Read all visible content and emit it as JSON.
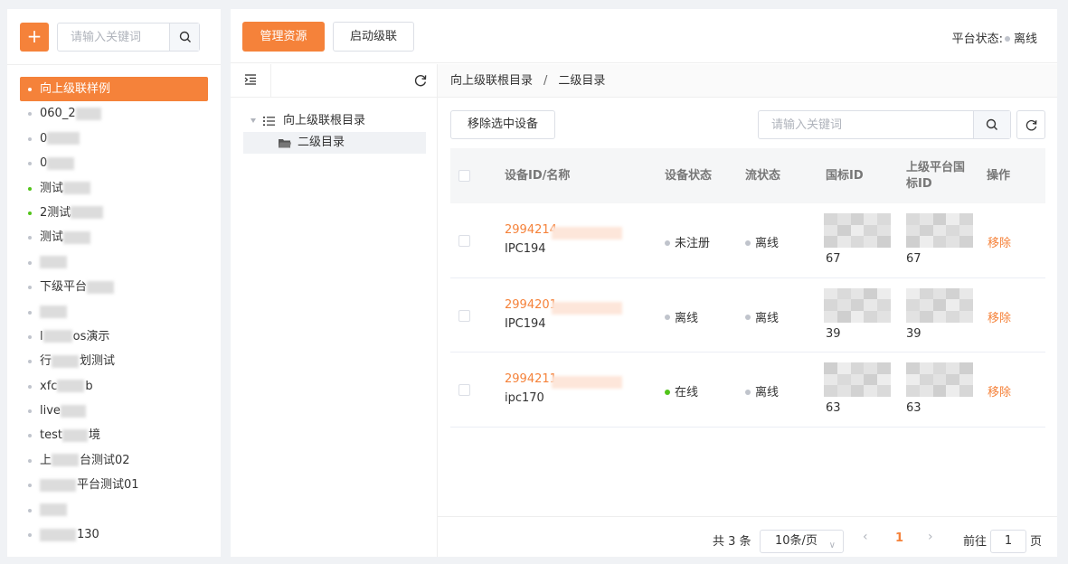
{
  "sidebar": {
    "add_label": "+",
    "search_placeholder": "请输入关键词",
    "items": [
      {
        "label": "向上级联样例",
        "active": true,
        "dot": "white"
      },
      {
        "label": "060_2",
        "dot": "gray"
      },
      {
        "label": "0",
        "dot": "gray"
      },
      {
        "label": "0",
        "dot": "gray"
      },
      {
        "label": "测试",
        "dot": "green"
      },
      {
        "label": "2测试",
        "dot": "green"
      },
      {
        "label": "测试",
        "dot": "gray"
      },
      {
        "label": "",
        "dot": "gray"
      },
      {
        "label": "下级平台",
        "dot": "gray"
      },
      {
        "label": "",
        "dot": "gray"
      },
      {
        "label": "l",
        "label_suffix": "os演示",
        "dot": "gray"
      },
      {
        "label": "行",
        "label_suffix": "划测试",
        "dot": "gray"
      },
      {
        "label": "xfc",
        "label_suffix": "b",
        "dot": "gray"
      },
      {
        "label": "live",
        "dot": "gray"
      },
      {
        "label": "test",
        "label_suffix": "境",
        "dot": "gray"
      },
      {
        "label": "上",
        "label_suffix": "台测试02",
        "dot": "gray"
      },
      {
        "label": "",
        "label_suffix": "平台测试01",
        "dot": "gray"
      },
      {
        "label": "",
        "dot": "gray"
      },
      {
        "label": "",
        "label_suffix": "130",
        "dot": "gray"
      }
    ]
  },
  "toolbar": {
    "manage_label": "管理资源",
    "cascade_label": "启动级联",
    "platform_status_label": "平台状态:",
    "platform_status_value": "离线"
  },
  "directory": {
    "root_label": "向上级联根目录",
    "child_label": "二级目录"
  },
  "breadcrumb": {
    "root": "向上级联根目录",
    "separator": "/",
    "current": "二级目录"
  },
  "actions": {
    "remove_selected_label": "移除选中设备",
    "search_placeholder": "请输入关键词"
  },
  "table": {
    "headers": {
      "device": "设备ID/名称",
      "device_status": "设备状态",
      "stream_status": "流状态",
      "gb_id": "国标ID",
      "parent_gb_id_line1": "上级平台国",
      "parent_gb_id_line2": "标ID",
      "ops": "操作"
    },
    "rows": [
      {
        "id": "2994214",
        "name": "IPC194",
        "device_status": "未注册",
        "device_online": false,
        "stream_status": "离线",
        "gb_suffix": "67",
        "parent_gb_suffix": "67",
        "op": "移除"
      },
      {
        "id": "2994201",
        "name": "IPC194",
        "device_status": "离线",
        "device_online": false,
        "stream_status": "离线",
        "gb_suffix": "39",
        "parent_gb_suffix": "39",
        "op": "移除"
      },
      {
        "id": "2994211",
        "name": "ipc170",
        "device_status": "在线",
        "device_online": true,
        "stream_status": "离线",
        "gb_suffix": "63",
        "parent_gb_suffix": "63",
        "op": "移除"
      }
    ]
  },
  "pagination": {
    "total": "共 3 条",
    "page_size": "10条/页",
    "current_page": "1",
    "goto_label": "前往",
    "goto_value": "1",
    "page_unit": "页"
  },
  "colors": {
    "accent": "#f5823a",
    "online": "#52c41a",
    "offline": "#c0c4cc"
  },
  "icons": [
    "search-icon",
    "outdent-icon",
    "refresh-icon",
    "list-icon",
    "folder-icon",
    "chevron-down-icon",
    "chevron-left-icon",
    "chevron-right-icon"
  ]
}
